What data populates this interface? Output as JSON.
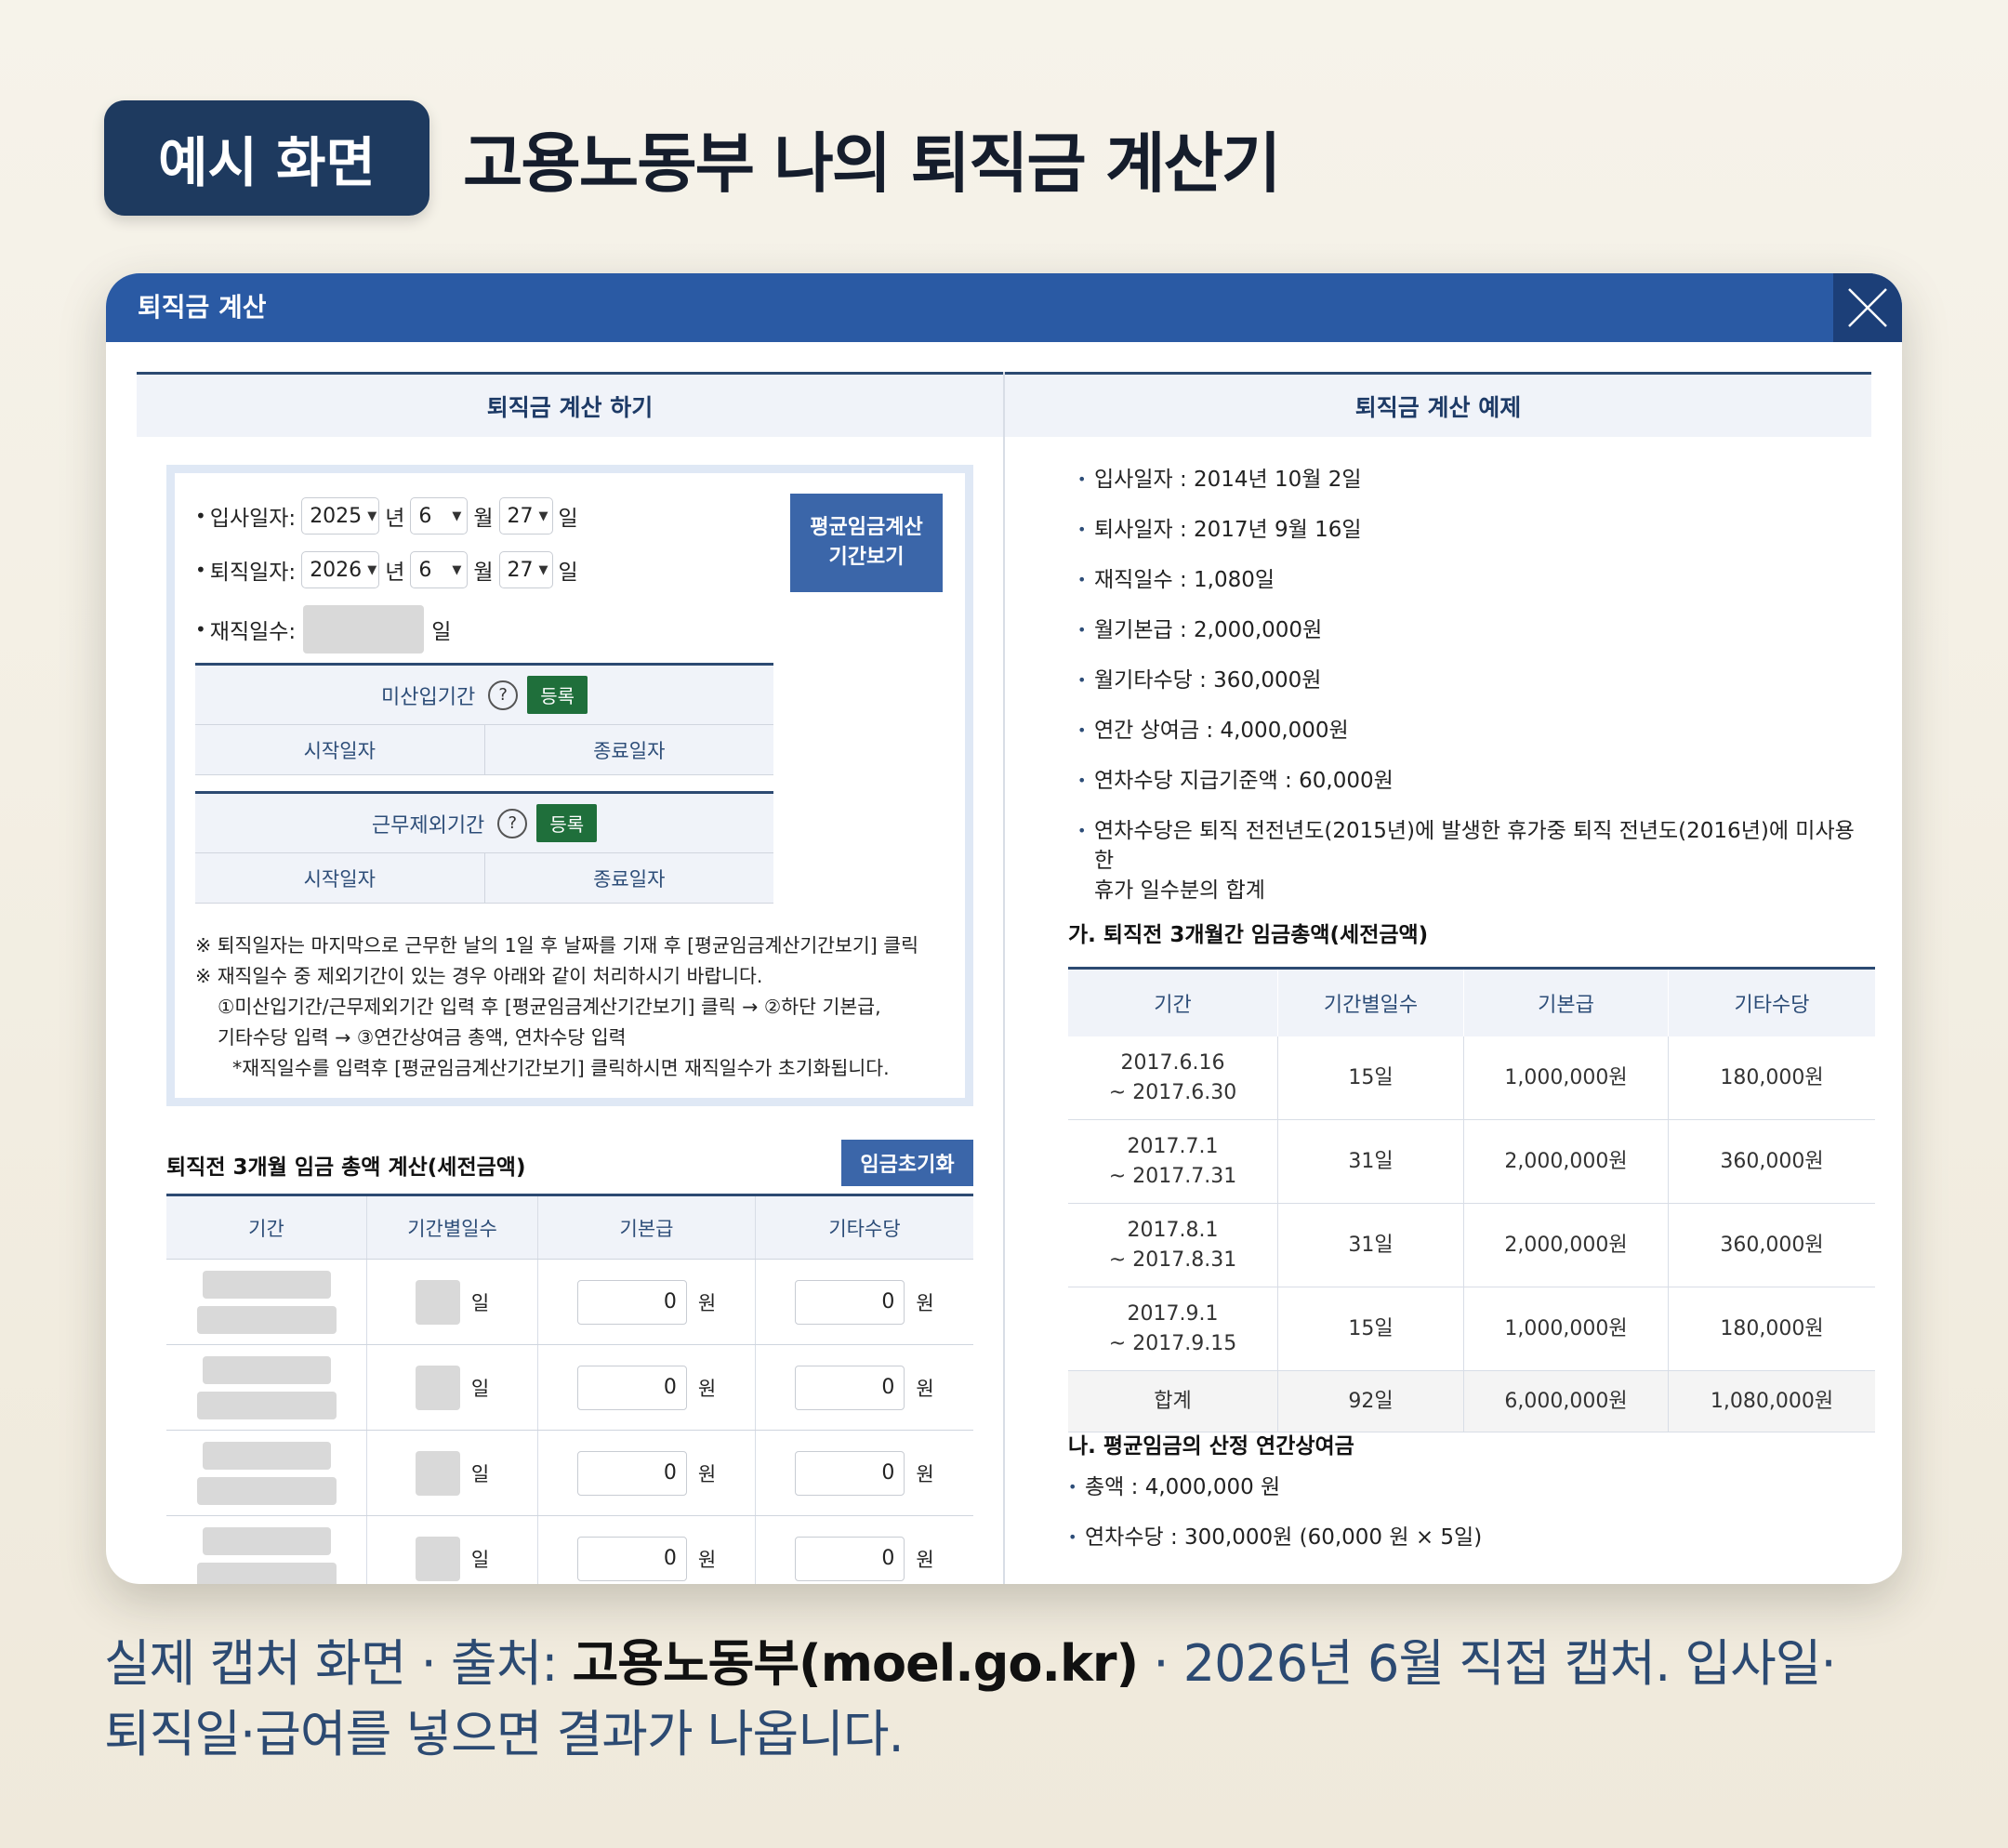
{
  "badge": "예시 화면",
  "headline": "고용노동부 나의 퇴직금 계산기",
  "window": {
    "title": "퇴직금 계산"
  },
  "left": {
    "heading": "퇴직금 계산 하기",
    "hire_label": "입사일자:",
    "retire_label": "퇴직일자:",
    "hire": {
      "year": "2025",
      "month": "6",
      "day": "27"
    },
    "retire": {
      "year": "2026",
      "month": "6",
      "day": "27"
    },
    "unit_year": "년",
    "unit_month": "월",
    "unit_day": "일",
    "tenure_label": "재직일수:",
    "tenure_unit": "일",
    "avg_btn_line1": "평균임금계산",
    "avg_btn_line2": "기간보기",
    "unpaid": {
      "title": "미산입기간",
      "q": "?",
      "reg": "등록",
      "start": "시작일자",
      "end": "종료일자"
    },
    "excluded": {
      "title": "근무제외기간",
      "q": "?",
      "reg": "등록",
      "start": "시작일자",
      "end": "종료일자"
    },
    "notes": [
      "※ 퇴직일자는 마지막으로 근무한 날의 1일 후 날짜를 기재 후 [평균임금계산기간보기] 클릭",
      "※ 재직일수 중 제외기간이 있는 경우 아래와 같이 처리하시기 바랍니다.",
      "①미산입기간/근무제외기간 입력 후 [평균임금계산기간보기] 클릭 → ②하단 기본급,",
      "기타수당 입력 → ③연간상여금 총액, 연차수당 입력",
      "*재직일수를 입력후 [평균임금계산기간보기] 클릭하시면 재직일수가 초기화됩니다."
    ],
    "wage_title": "퇴직전 3개월 임금 총액 계산(세전금액)",
    "reset_btn": "임금초기화",
    "table_headers": [
      "기간",
      "기간별일수",
      "기본급",
      "기타수당"
    ],
    "rows": [
      {
        "day_unit": "일",
        "base": "0",
        "other": "0",
        "won": "원"
      },
      {
        "day_unit": "일",
        "base": "0",
        "other": "0",
        "won": "원"
      },
      {
        "day_unit": "일",
        "base": "0",
        "other": "0",
        "won": "원"
      },
      {
        "day_unit": "일",
        "base": "0",
        "other": "0",
        "won": "원"
      }
    ]
  },
  "right": {
    "heading": "퇴직금 계산 예제",
    "items": [
      "입사일자 : 2014년 10월 2일",
      "퇴사일자 : 2017년 9월 16일",
      "재직일수 : 1,080일",
      "월기본급 : 2,000,000원",
      "월기타수당 : 360,000원",
      "연간 상여금 : 4,000,000원",
      "연차수당 지급기준액 : 60,000원",
      "연차수당은 퇴직 전전년도(2015년)에 발생한 휴가중 퇴직 전년도(2016년)에 미사용한"
    ],
    "item_cont": "휴가 일수분의 합계",
    "sec_a": "가. 퇴직전 3개월간 임금총액(세전금액)",
    "table_headers": [
      "기간",
      "기간별일수",
      "기본급",
      "기타수당"
    ],
    "rows": [
      {
        "p1": "2017.6.16",
        "p2": "~ 2017.6.30",
        "days": "15일",
        "base": "1,000,000원",
        "other": "180,000원"
      },
      {
        "p1": "2017.7.1",
        "p2": "~ 2017.7.31",
        "days": "31일",
        "base": "2,000,000원",
        "other": "360,000원"
      },
      {
        "p1": "2017.8.1",
        "p2": "~ 2017.8.31",
        "days": "31일",
        "base": "2,000,000원",
        "other": "360,000원"
      },
      {
        "p1": "2017.9.1",
        "p2": "~ 2017.9.15",
        "days": "15일",
        "base": "1,000,000원",
        "other": "180,000원"
      }
    ],
    "sum": {
      "label": "합계",
      "days": "92일",
      "base": "6,000,000원",
      "other": "1,080,000원"
    },
    "sec_b": "나. 평균임금의 산정 연간상여금",
    "b_items": [
      "총액 : 4,000,000 원",
      "연차수당 : 300,000원 (60,000 원 × 5일)"
    ]
  },
  "caption": {
    "pre": "실제 캡처 화면 · 출처: ",
    "source": "고용노동부(moel.go.kr)",
    "post": " · 2026년 6월 직접 캡처. 입사일·",
    "line2": "퇴직일·급여를 넣으면 결과가 나옵니다."
  }
}
